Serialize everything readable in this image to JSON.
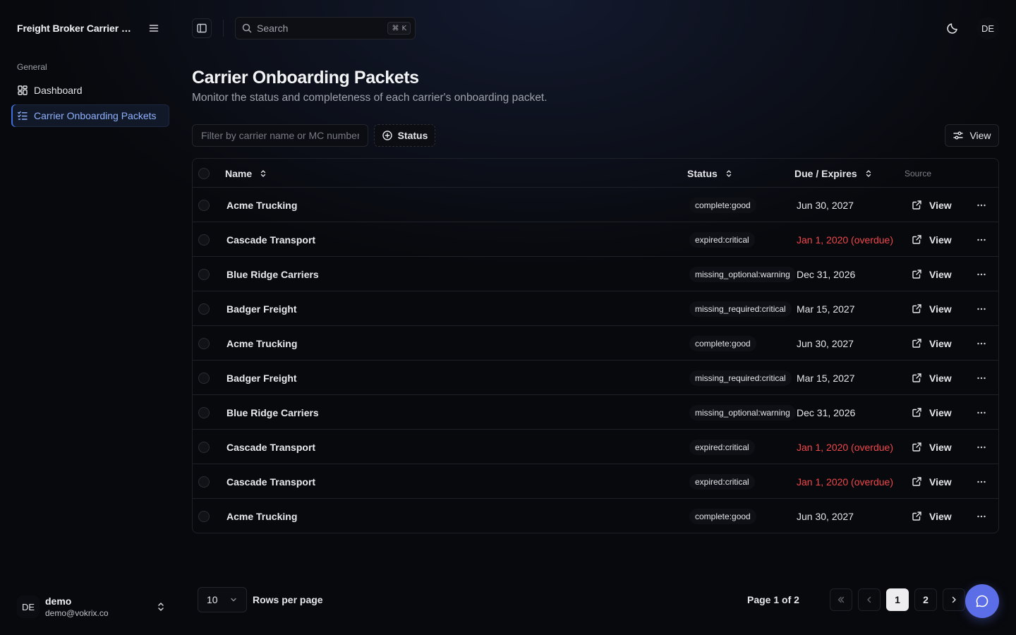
{
  "app": {
    "title": "Freight Broker Carrier Onboarding"
  },
  "sidebar": {
    "group_label": "General",
    "items": [
      {
        "label": "Dashboard",
        "icon": "dashboard-icon",
        "active": false
      },
      {
        "label": "Carrier Onboarding Packets",
        "icon": "list-checks-icon",
        "active": true
      }
    ],
    "user": {
      "initials": "DE",
      "name": "demo",
      "email": "demo@vokrix.co"
    }
  },
  "topbar": {
    "search_placeholder": "Search",
    "shortcut_symbol": "⌘",
    "shortcut_key": "K",
    "avatar_initials": "DE"
  },
  "page": {
    "title": "Carrier Onboarding Packets",
    "subtitle": "Monitor the status and completeness of each carrier's onboarding packet."
  },
  "toolbar": {
    "filter_placeholder": "Filter by carrier name or MC number...",
    "status_label": "Status",
    "view_label": "View"
  },
  "table": {
    "columns": {
      "name": "Name",
      "status": "Status",
      "due": "Due / Expires",
      "source": "Source"
    },
    "link_label": "View",
    "rows": [
      {
        "name": "Acme Trucking",
        "status": "complete:good",
        "due": "Jun 30, 2027",
        "overdue": false
      },
      {
        "name": "Cascade Transport",
        "status": "expired:critical",
        "due": "Jan 1, 2020 (overdue)",
        "overdue": true
      },
      {
        "name": "Blue Ridge Carriers",
        "status": "missing_optional:warning",
        "due": "Dec 31, 2026",
        "overdue": false
      },
      {
        "name": "Badger Freight",
        "status": "missing_required:critical",
        "due": "Mar 15, 2027",
        "overdue": false
      },
      {
        "name": "Acme Trucking",
        "status": "complete:good",
        "due": "Jun 30, 2027",
        "overdue": false
      },
      {
        "name": "Badger Freight",
        "status": "missing_required:critical",
        "due": "Mar 15, 2027",
        "overdue": false
      },
      {
        "name": "Blue Ridge Carriers",
        "status": "missing_optional:warning",
        "due": "Dec 31, 2026",
        "overdue": false
      },
      {
        "name": "Cascade Transport",
        "status": "expired:critical",
        "due": "Jan 1, 2020 (overdue)",
        "overdue": true
      },
      {
        "name": "Cascade Transport",
        "status": "expired:critical",
        "due": "Jan 1, 2020 (overdue)",
        "overdue": true
      },
      {
        "name": "Acme Trucking",
        "status": "complete:good",
        "due": "Jun 30, 2027",
        "overdue": false
      }
    ]
  },
  "pagination": {
    "rows_per_page_value": "10",
    "rows_per_page_label": "Rows per page",
    "page_info": "Page 1 of 2",
    "page_1": "1",
    "page_2": "2",
    "current_page": 1
  },
  "colors": {
    "accent": "#5b6ee8",
    "overdue": "#f0474a",
    "active_nav": "#8fb2ff",
    "background": "#08090d"
  }
}
